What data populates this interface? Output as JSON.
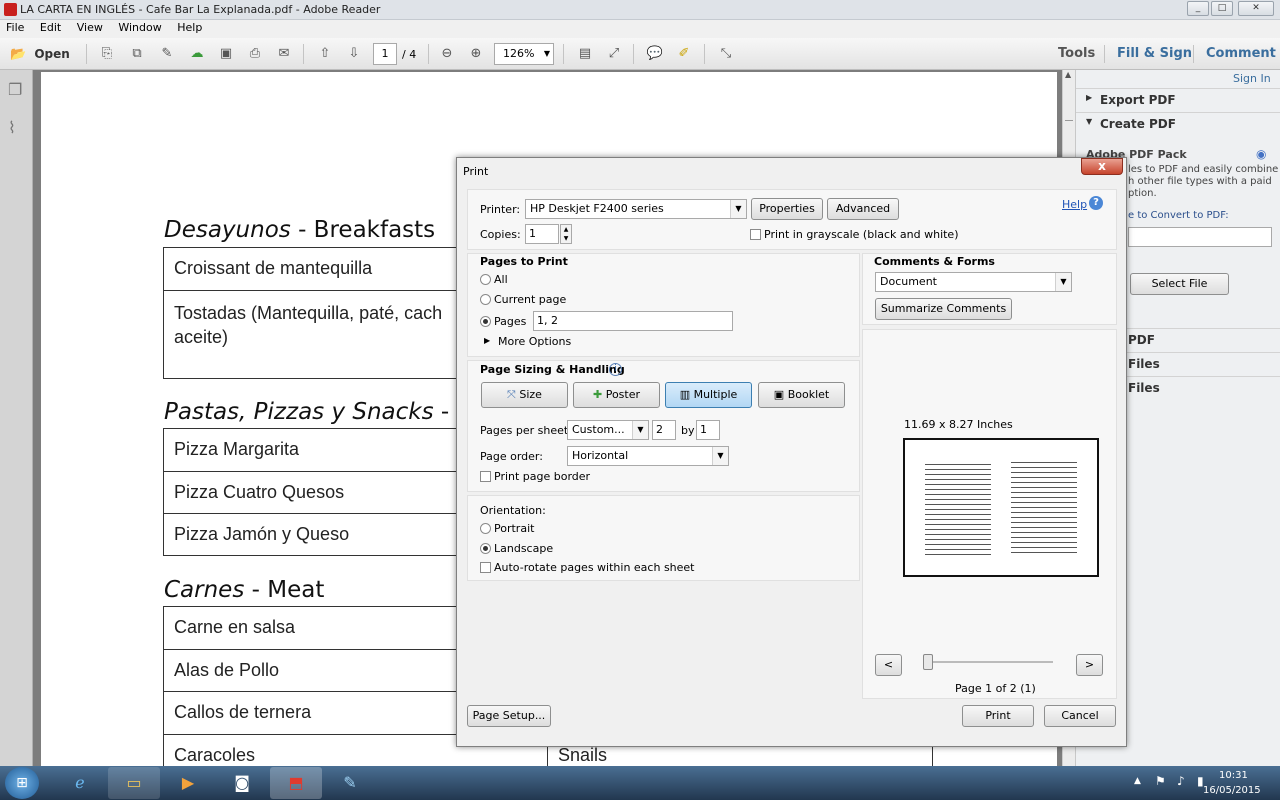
{
  "window": {
    "title": "LA CARTA EN INGLÉS - Cafe Bar La Explanada.pdf - Adobe Reader"
  },
  "menu": [
    "File",
    "Edit",
    "View",
    "Window",
    "Help"
  ],
  "toolbar": {
    "open_label": "Open",
    "page_current": "1",
    "page_total": "/ 4",
    "zoom": "126%",
    "tools": "Tools",
    "fill_sign": "Fill & Sign",
    "comment": "Comment"
  },
  "right_panel": {
    "sign_in": "Sign In",
    "export_pdf": "Export PDF",
    "create_pdf": "Create PDF",
    "pack_title": "Adobe PDF Pack",
    "pack_desc1": "les to PDF and easily combine",
    "pack_desc2": "h other file types with a paid",
    "pack_desc3": "ption.",
    "convert_label": "e to Convert to PDF:",
    "select_file": "Select File",
    "sec1": "PDF",
    "sec2": "Files",
    "sec3": "Files"
  },
  "document": {
    "h1_es": "Desayunos",
    "h1_en": " - Breakfasts",
    "t1": [
      "Croissant de mantequilla",
      "Tostadas (Mantequilla, paté, cach",
      "aceite)"
    ],
    "h2_es": "Pastas, Pizzas y Snacks",
    "h2_en": " -",
    "t2": [
      "Pizza Margarita",
      "Pizza Cuatro Quesos",
      "Pizza Jamón y Queso"
    ],
    "h3_es": "Carnes",
    "h3_en": " - Meat",
    "t3": [
      "Carne en salsa",
      "Alas de Pollo",
      "Callos de ternera",
      "Caracoles"
    ],
    "snails": "Snails"
  },
  "dialog": {
    "title": "Print",
    "close": "x",
    "printer_label": "Printer:",
    "printer_value": "HP Deskjet F2400 series",
    "properties": "Properties",
    "advanced": "Advanced",
    "help": "Help",
    "copies_label": "Copies:",
    "copies_value": "1",
    "grayscale": "Print in grayscale (black and white)",
    "pages_to_print": "Pages to Print",
    "all": "All",
    "current_page": "Current page",
    "pages": "Pages",
    "pages_value": "1, 2",
    "more_options": "More Options",
    "sizing_title": "Page Sizing & Handling",
    "size": "Size",
    "poster": "Poster",
    "multiple": "Multiple",
    "booklet": "Booklet",
    "pps_label": "Pages per sheet:",
    "pps_value": "Custom...",
    "pps_x": "2",
    "by": "by",
    "pps_y": "1",
    "order_label": "Page order:",
    "order_value": "Horizontal",
    "border": "Print page border",
    "orientation": "Orientation:",
    "portrait": "Portrait",
    "landscape": "Landscape",
    "autorotate": "Auto-rotate pages within each sheet",
    "comments_forms": "Comments & Forms",
    "comments_value": "Document",
    "summarize": "Summarize Comments",
    "paper_size": "11.69 x 8.27 Inches",
    "prev": "<",
    "next": ">",
    "page_of": "Page 1 of 2 (1)",
    "page_setup": "Page Setup...",
    "print": "Print",
    "cancel": "Cancel"
  },
  "taskbar": {
    "time": "10:31",
    "date": "16/05/2015"
  }
}
